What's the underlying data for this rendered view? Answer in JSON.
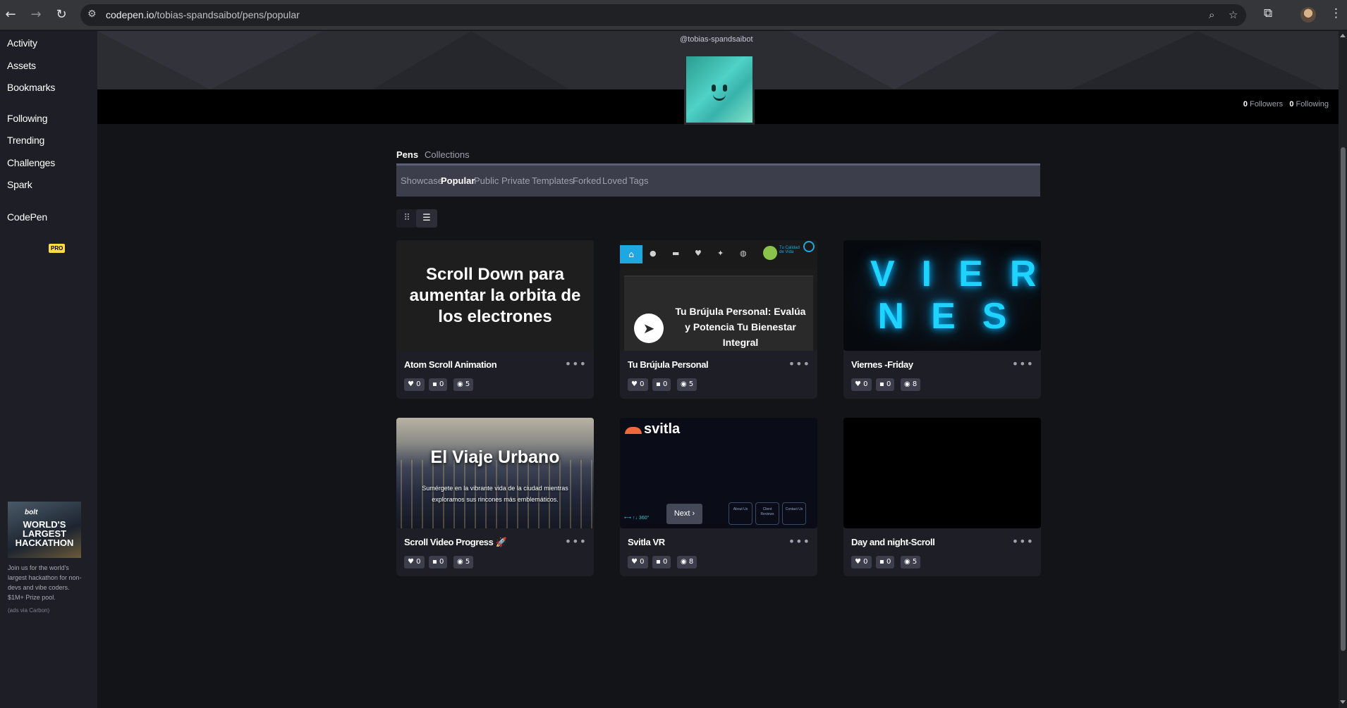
{
  "browser": {
    "url_host": "codepen.io",
    "url_path": "/tobias-spandsaibot/pens/popular",
    "icons": [
      "back-arrow-icon",
      "forward-arrow-icon",
      "reload-icon",
      "site-settings-icon",
      "zoom-icon",
      "bookmark-star-icon",
      "extensions-icon",
      "profile-avatar",
      "menu-icon"
    ]
  },
  "sidebar": {
    "items": [
      {
        "label": "Activity"
      },
      {
        "label": "Assets"
      },
      {
        "label": "Bookmarks"
      },
      {
        "label": "Following"
      },
      {
        "label": "Trending"
      },
      {
        "label": "Challenges"
      },
      {
        "label": "Spark"
      },
      {
        "label": "CodePen"
      }
    ],
    "pro_badge": "PRO",
    "ad": {
      "image_brand": "bolt",
      "image_headline": "WORLD'S LARGEST HACKATHON",
      "text": "Join us for the world's largest hackathon for non-devs and vibe coders. $1M+ Prize pool.",
      "via": "(ads via Carbon)"
    }
  },
  "profile": {
    "username": "@tobias-spandsaibot",
    "followers_count": "0",
    "followers_label": "Followers",
    "following_count": "0",
    "following_label": "Following"
  },
  "tabs": {
    "pens": "Pens",
    "collections": "Collections"
  },
  "filters": [
    "Showcase",
    "Popular",
    "Public",
    "Private",
    "Templates",
    "Forked",
    "Loved",
    "Tags"
  ],
  "active_filter": "Popular",
  "view_toggle": {
    "grid_icon": "grid-view-icon",
    "list_icon": "list-view-icon",
    "active": "list"
  },
  "pens": [
    {
      "title": "Atom Scroll Animation",
      "hearts": "0",
      "comments": "0",
      "views": "5",
      "thumb_text": "Scroll Down para aumentar la orbita de los electrones"
    },
    {
      "title": "Tu Brújula Personal",
      "hearts": "0",
      "comments": "0",
      "views": "5",
      "thumb_text": "Tu Brújula Personal: Evalúa y Potencia Tu Bienestar Integral",
      "thumb_logo_text": "Tu Calidad de Vida"
    },
    {
      "title": "Viernes -Friday",
      "hearts": "0",
      "comments": "0",
      "views": "8",
      "thumb_line1": "VIER",
      "thumb_line2": "NES"
    },
    {
      "title": "Scroll Video Progress 🚀",
      "hearts": "0",
      "comments": "0",
      "views": "5",
      "thumb_title": "El Viaje Urbano",
      "thumb_sub": "Sumérgete en la vibrante vida de la ciudad mientras exploramos sus rincones más emblemáticos."
    },
    {
      "title": "Svitla VR",
      "hearts": "0",
      "comments": "0",
      "views": "8",
      "thumb_logo": "svitla",
      "thumb_vr": "⟷ ↑↓ 360°",
      "thumb_buttons": [
        "About Us",
        "Client Reviews",
        "Contact Us"
      ]
    },
    {
      "title": "Day and night-Scroll",
      "hearts": "0",
      "comments": "0",
      "views": "5"
    }
  ],
  "pagination": {
    "next_label": "Next ›"
  }
}
